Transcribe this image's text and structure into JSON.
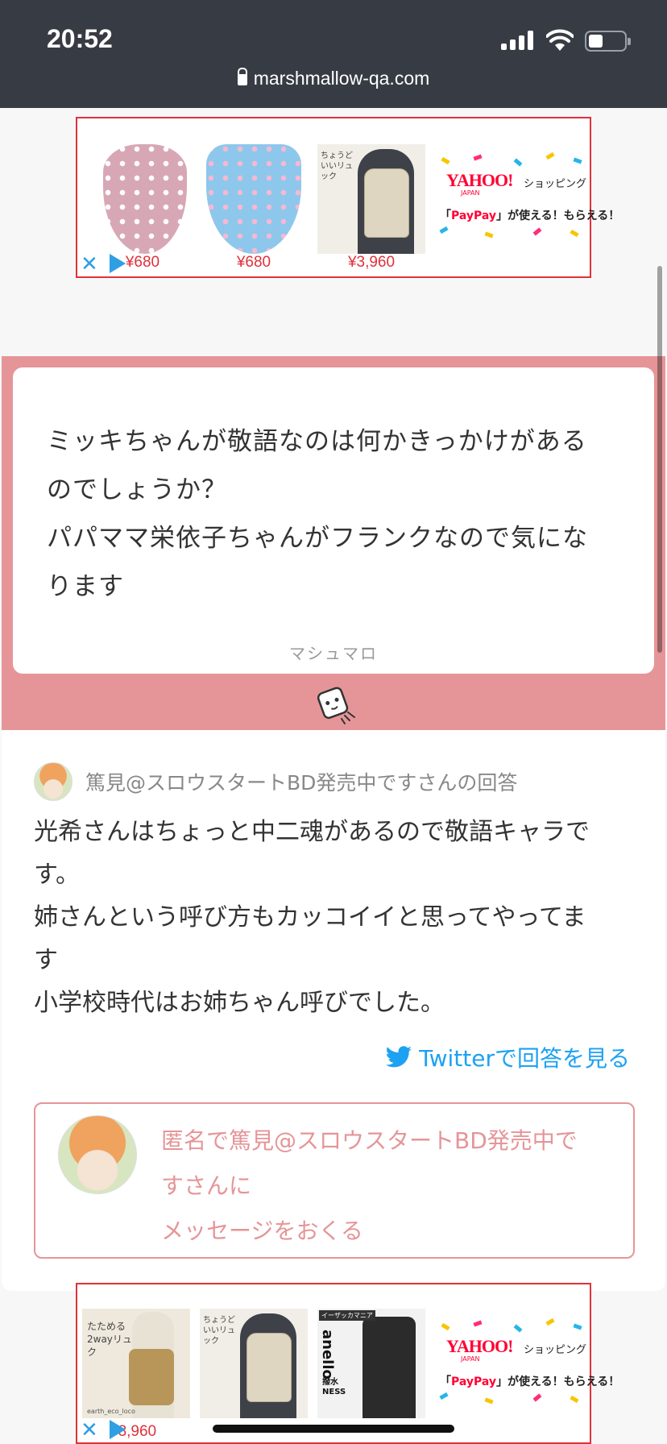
{
  "status_bar": {
    "time": "20:52",
    "url": "marshmallow-qa.com"
  },
  "ad_top": {
    "prices": [
      "¥680",
      "¥680",
      "¥3,960"
    ],
    "bag_caption": "ちょうどいいリュック",
    "yahoo": {
      "logo": "YAHOO!",
      "japan": "JAPAN",
      "shopping": "ショッピング",
      "paypay_brand": "PayPay",
      "paypay_rest": "」が使える！もらえる！",
      "paypay_open": "「"
    },
    "close_glyph": "✕"
  },
  "question": {
    "lines": [
      "ミッキちゃんが敬語なのは何かきっかけがある",
      "のでしょうか？",
      "パパママ栄依子ちゃんがフランクなので気にな",
      "ります"
    ],
    "footer": "マシュマロ"
  },
  "answer": {
    "header": "篤見@スロウスタートBD発売中ですさんの回答",
    "lines": [
      "光希さんはちょっと中二魂があるので敬語キャラで",
      "す。",
      "姉さんという呼び方もカッコイイと思ってやってま",
      "す",
      "小学校時代はお姉ちゃん呼びでした。"
    ],
    "twitter_link": "Twitterで回答を見る",
    "send_lines": [
      "匿名で篤見@スロウスタートBD発売中で",
      "すさんに",
      "メッセージをおくる"
    ]
  },
  "ad_bottom": {
    "item1_caption": "たためる 2wayリュック",
    "item1_brand": "earth_eco_loco",
    "item2_caption": "ちょうどいいリュック",
    "item3_brand": "anello",
    "item3_tag": "撥水 NESS",
    "item3_badge": "イーザッカマニア",
    "price_visible": "¥3,960",
    "yahoo": {
      "logo": "YAHOO!",
      "japan": "JAPAN",
      "shopping": "ショッピング",
      "paypay_brand": "PayPay",
      "paypay_rest": "」が使える！もらえる！",
      "paypay_open": "「"
    },
    "close_glyph": "✕"
  },
  "colors": {
    "accent_pink": "#e59598",
    "twitter_blue": "#1da1f2",
    "ad_red": "#e0313b"
  }
}
